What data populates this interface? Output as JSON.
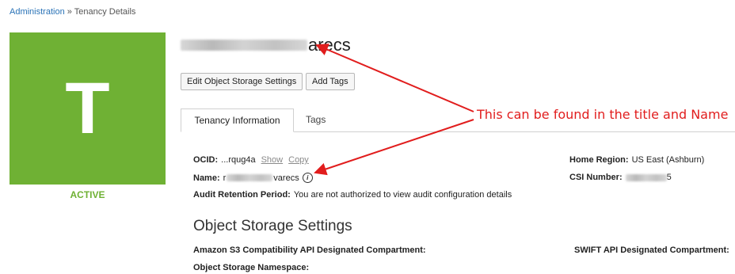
{
  "breadcrumb": {
    "root": "Administration",
    "separator": "»",
    "current": "Tenancy Details"
  },
  "avatar": {
    "letter": "T",
    "status": "ACTIVE",
    "color": "#6fb134"
  },
  "header": {
    "title_suffix": "arecs"
  },
  "toolbar": {
    "edit_label": "Edit Object Storage Settings",
    "add_tags_label": "Add Tags"
  },
  "tabs": [
    {
      "label": "Tenancy Information",
      "active": true
    },
    {
      "label": "Tags",
      "active": false
    }
  ],
  "tenancy_info": {
    "ocid_label": "OCID:",
    "ocid_value": "...rqug4a",
    "show_label": "Show",
    "copy_label": "Copy",
    "name_label": "Name:",
    "name_prefix": "r",
    "name_suffix": "varecs",
    "audit_label": "Audit Retention Period:",
    "audit_value": "You are not authorized to view audit configuration details",
    "home_region_label": "Home Region:",
    "home_region_value": "US East (Ashburn)",
    "csi_label": "CSI Number:",
    "csi_suffix": "5"
  },
  "object_storage": {
    "title": "Object Storage Settings",
    "s3_label": "Amazon S3 Compatibility API Designated Compartment:",
    "swift_label": "SWIFT API Designated Compartment:",
    "namespace_label": "Object Storage Namespace:"
  },
  "annotation": {
    "text": "This can be found in the title and Name",
    "color": "#e11d1d"
  }
}
